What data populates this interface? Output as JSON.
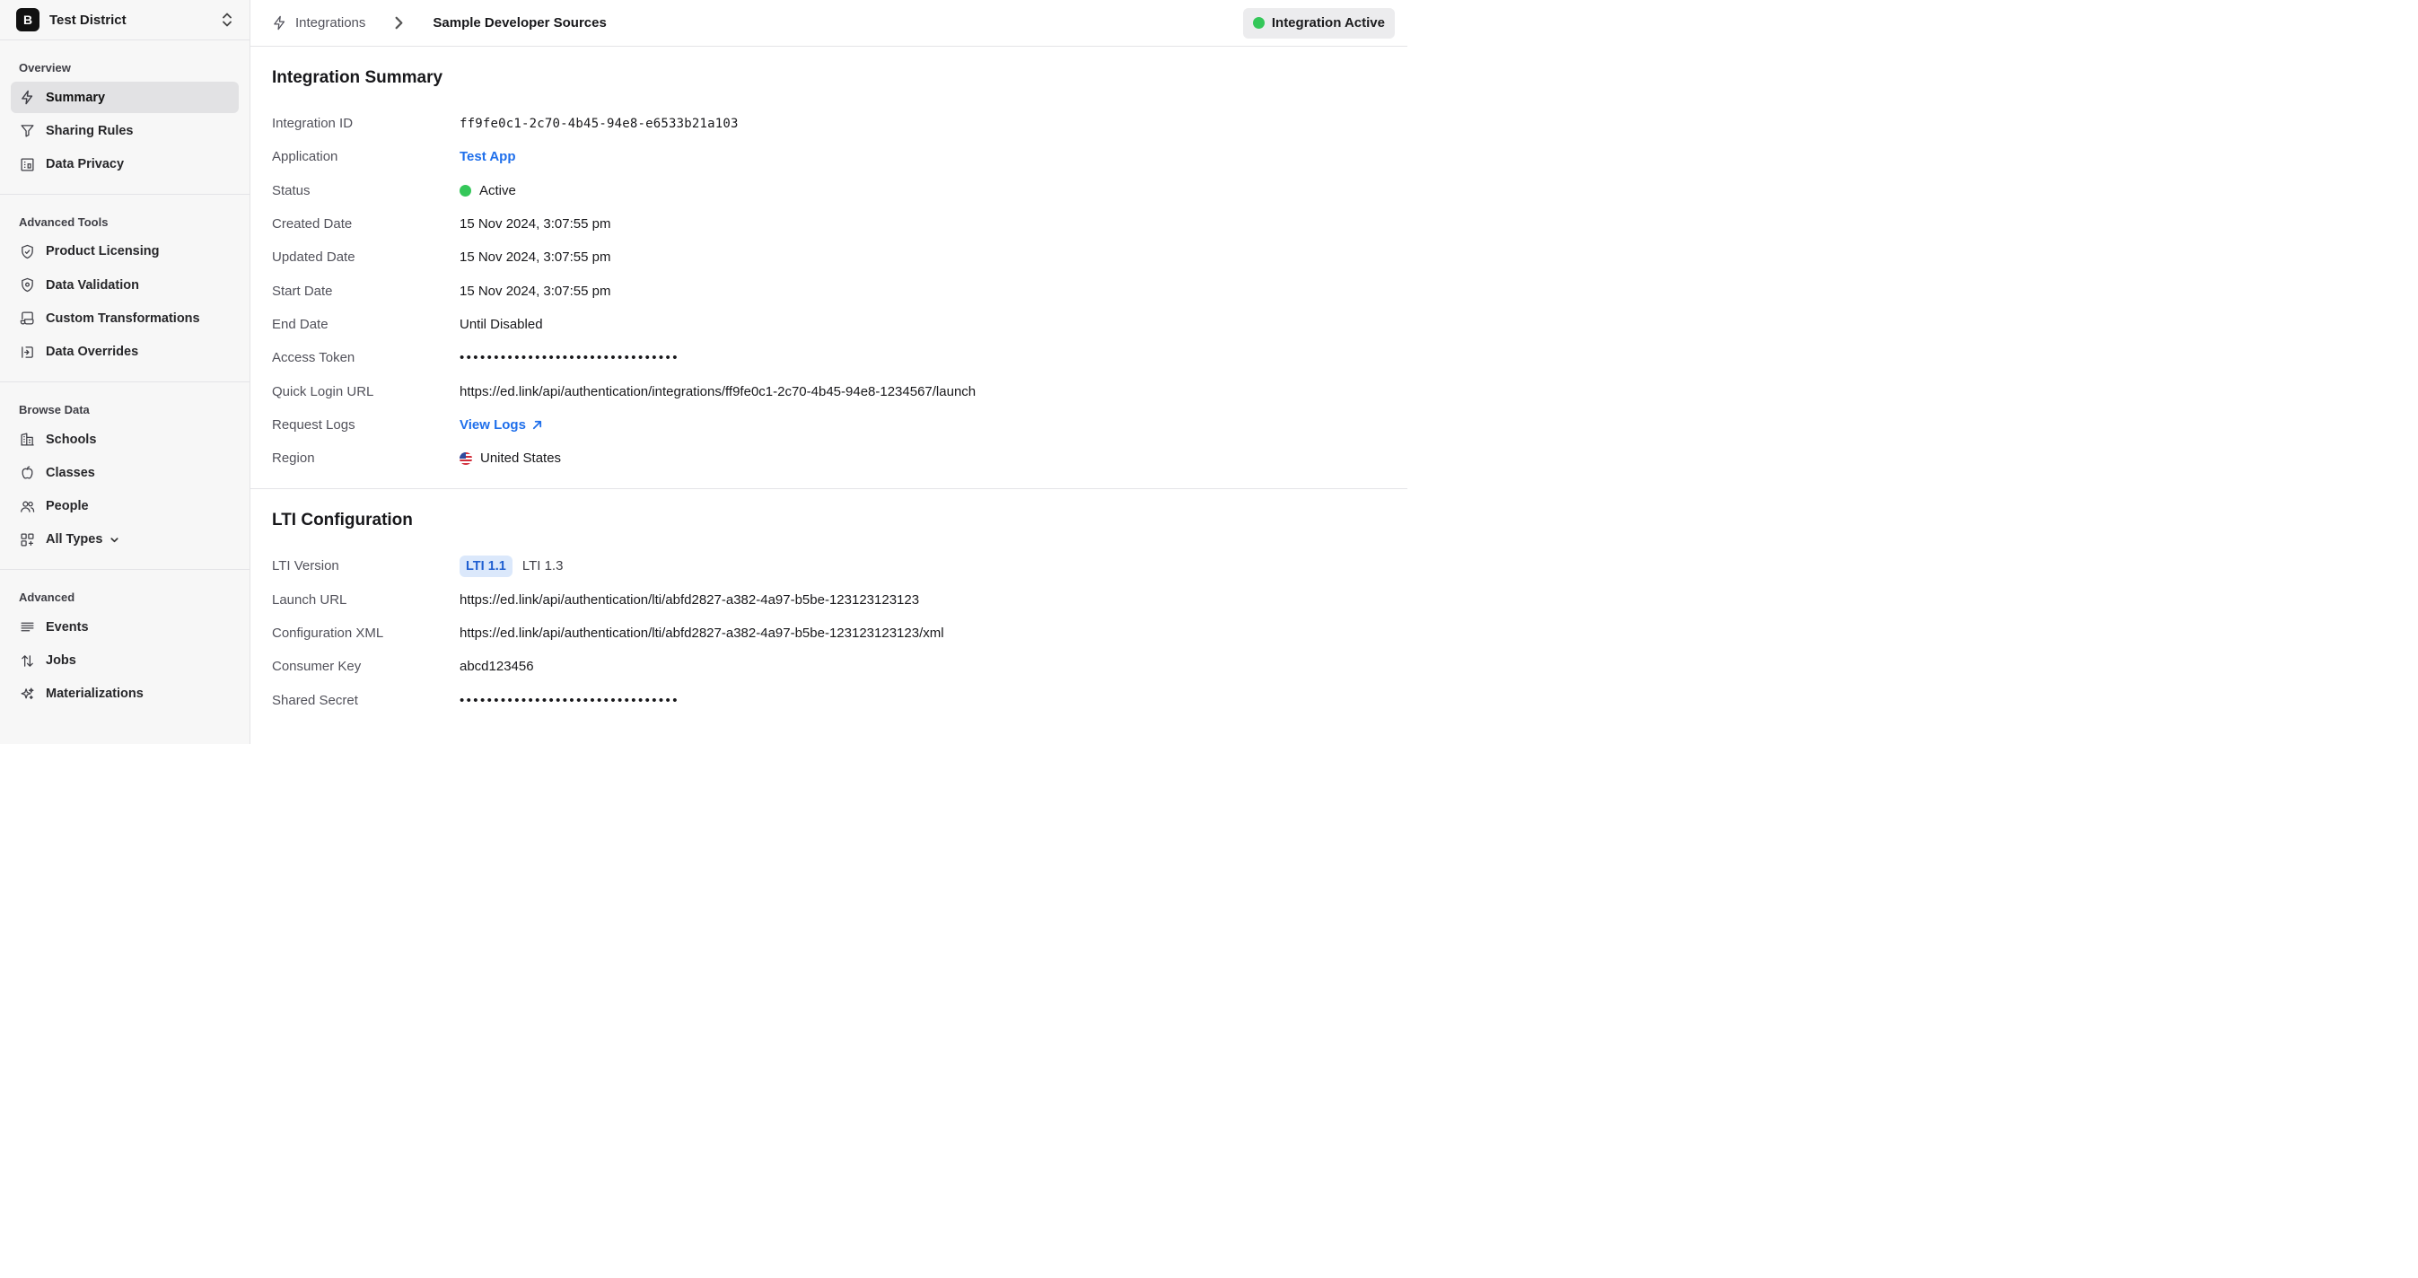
{
  "org": {
    "initial": "B",
    "name": "Test District"
  },
  "sidebar": {
    "sections": [
      {
        "title": "Overview",
        "items": [
          "Summary",
          "Sharing Rules",
          "Data Privacy"
        ]
      },
      {
        "title": "Advanced Tools",
        "items": [
          "Product Licensing",
          "Data Validation",
          "Custom Transformations",
          "Data Overrides"
        ]
      },
      {
        "title": "Browse Data",
        "items": [
          "Schools",
          "Classes",
          "People",
          "All Types"
        ]
      },
      {
        "title": "Advanced",
        "items": [
          "Events",
          "Jobs",
          "Materializations"
        ]
      }
    ],
    "active_item": "Summary"
  },
  "breadcrumb": {
    "parent": "Integrations",
    "current": "Sample Developer Sources"
  },
  "status_pill": {
    "label": "Integration Active",
    "color": "#34c759"
  },
  "summary": {
    "title": "Integration Summary",
    "labels": {
      "integration_id": "Integration ID",
      "application": "Application",
      "status": "Status",
      "created": "Created Date",
      "updated": "Updated Date",
      "start": "Start Date",
      "end": "End Date",
      "token": "Access Token",
      "quick_login": "Quick Login URL",
      "request_logs": "Request Logs",
      "region": "Region"
    },
    "values": {
      "integration_id": "ff9fe0c1-2c70-4b45-94e8-e6533b21a103",
      "application": "Test App",
      "status": "Active",
      "created": "15 Nov 2024, 3:07:55 pm",
      "updated": "15 Nov 2024, 3:07:55 pm",
      "start": "15 Nov 2024, 3:07:55 pm",
      "end": "Until Disabled",
      "token": "••••••••••••••••••••••••••••••••",
      "quick_login": "https://ed.link/api/authentication/integrations/ff9fe0c1-2c70-4b45-94e8-1234567/launch",
      "request_logs": "View Logs",
      "region": "United States"
    }
  },
  "lti": {
    "title": "LTI Configuration",
    "labels": {
      "version": "LTI Version",
      "launch_url": "Launch URL",
      "config_xml": "Configuration XML",
      "consumer_key": "Consumer Key",
      "shared_secret": "Shared Secret"
    },
    "versions": [
      "LTI 1.1",
      "LTI 1.3"
    ],
    "selected_version": "LTI 1.1",
    "values": {
      "launch_url": "https://ed.link/api/authentication/lti/abfd2827-a382-4a97-b5be-123123123123",
      "config_xml": "https://ed.link/api/authentication/lti/abfd2827-a382-4a97-b5be-123123123123/xml",
      "consumer_key": "abcd123456",
      "shared_secret": "••••••••••••••••••••••••••••••••"
    }
  }
}
